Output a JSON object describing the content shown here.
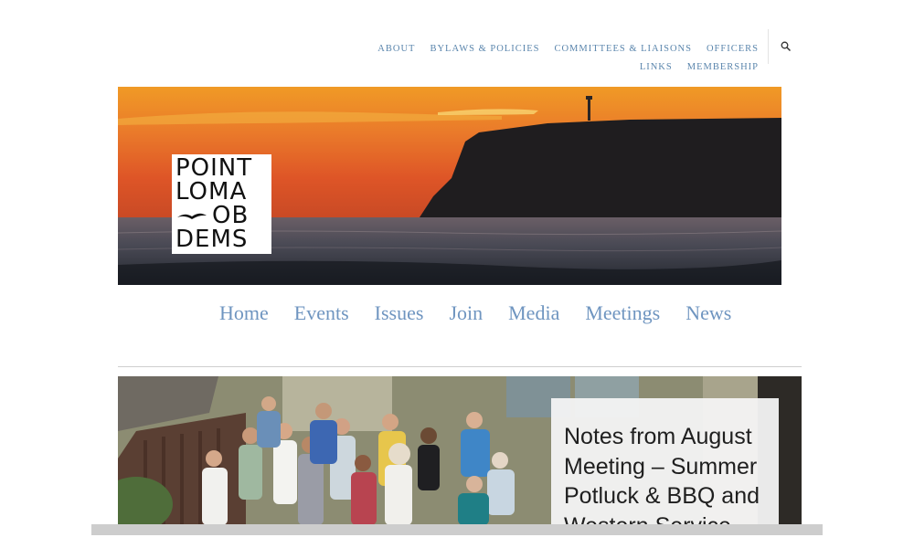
{
  "top_nav": {
    "row1": [
      "ABOUT",
      "BYLAWS & POLICIES",
      "COMMITTEES & LIAISONS",
      "OFFICERS"
    ],
    "row2": [
      "LINKS",
      "MEMBERSHIP"
    ],
    "search_icon": "magnifier-icon"
  },
  "logo": {
    "line1": "POINT",
    "line2": "LOMA",
    "line3": "OB",
    "line4": "DEMS"
  },
  "main_nav": [
    "Home",
    "Events",
    "Issues",
    "Join",
    "Media",
    "Meetings",
    "News"
  ],
  "feature_post": {
    "title": "Notes from August Meeting – Summer Potluck & BBQ and Western Service"
  },
  "colors": {
    "nav_link": "#5b86ad",
    "main_nav_link": "#6f95c0",
    "sunset_orange": "#e2552a"
  }
}
